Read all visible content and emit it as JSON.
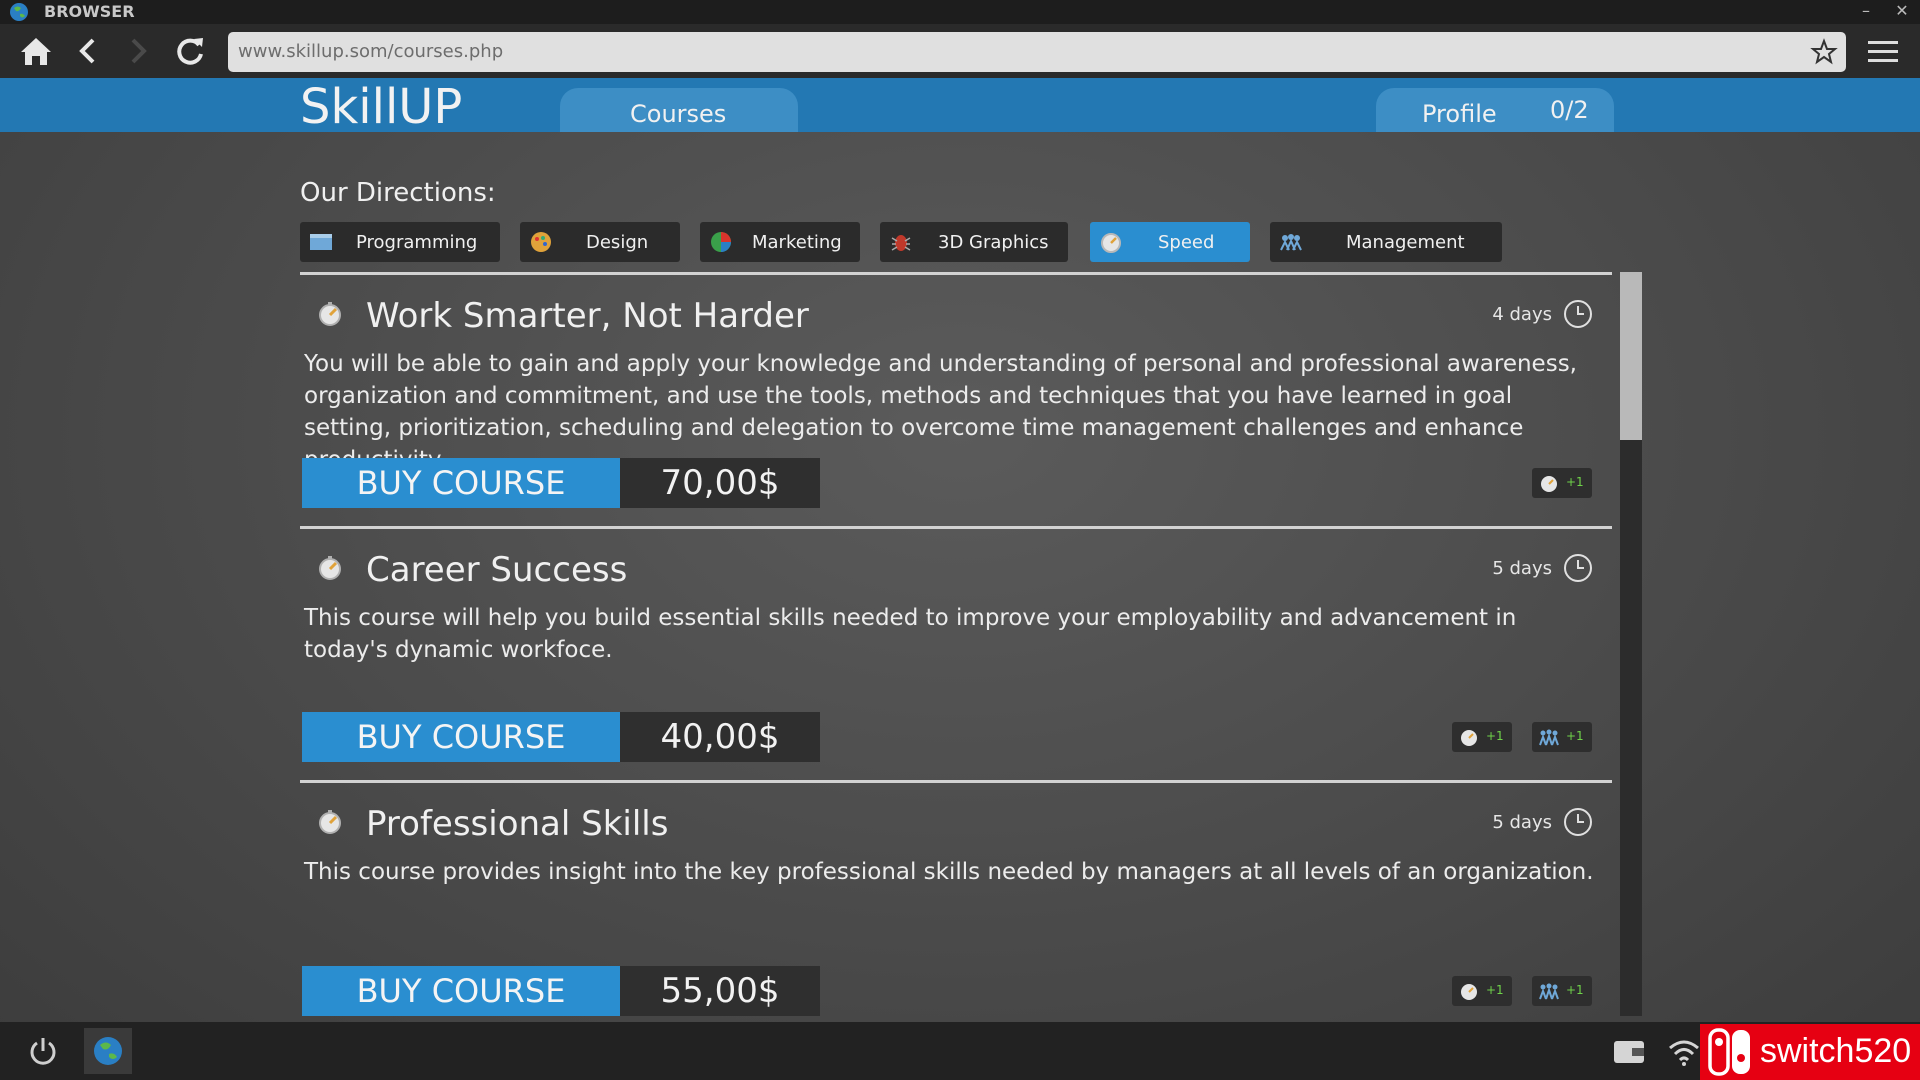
{
  "window": {
    "title": "BROWSER",
    "minimize": "–",
    "close": "✕"
  },
  "toolbar": {
    "home_icon": "home-icon",
    "back_icon": "back-arrow-icon",
    "forward_icon": "forward-arrow-icon",
    "reload_icon": "reload-icon",
    "url": "www.skillup.som/courses.php",
    "bookmark_icon": "star-icon",
    "menu_icon": "hamburger-menu-icon"
  },
  "site": {
    "logo": "SkillUP",
    "tabs": {
      "courses": "Courses",
      "profile": "Profile",
      "profile_count": "0/2"
    }
  },
  "directions": {
    "label": "Our Directions:",
    "items": [
      {
        "label": "Programming",
        "icon": "code-window-icon"
      },
      {
        "label": "Design",
        "icon": "palette-icon"
      },
      {
        "label": "Marketing",
        "icon": "pie-chart-icon"
      },
      {
        "label": "3D Graphics",
        "icon": "bug-icon"
      },
      {
        "label": "Speed",
        "icon": "stopwatch-icon",
        "active": true
      },
      {
        "label": "Management",
        "icon": "team-icon"
      }
    ]
  },
  "courses": [
    {
      "title": "Work Smarter, Not Harder",
      "duration": "4 days",
      "description": "You will be able to gain and apply your knowledge and understanding of personal and professional awareness, organization and commitment, and use the tools, methods and techniques that you have learned in goal setting, prioritization, scheduling and delegation to overcome time management challenges and enhance productivity.",
      "buy_label": "BUY COURSE",
      "price": "70,00$",
      "rewards": [
        {
          "icon": "stopwatch-icon",
          "label": "+1"
        }
      ]
    },
    {
      "title": "Career Success",
      "duration": "5 days",
      "description": "This course will help you build essential skills needed to improve your employability and advancement in today's dynamic workfoce.",
      "buy_label": "BUY COURSE",
      "price": "40,00$",
      "rewards": [
        {
          "icon": "stopwatch-icon",
          "label": "+1"
        },
        {
          "icon": "team-icon",
          "label": "+1"
        }
      ]
    },
    {
      "title": "Professional Skills",
      "duration": "5 days",
      "description": "This course provides insight into the key professional skills needed by managers at all levels of an organization.",
      "buy_label": "BUY COURSE",
      "price": "55,00$",
      "rewards": [
        {
          "icon": "stopwatch-icon",
          "label": "+1"
        },
        {
          "icon": "team-icon",
          "label": "+1"
        }
      ]
    }
  ],
  "taskbar": {
    "power_icon": "power-icon",
    "browser_icon": "globe-icon",
    "wallet_icon": "wallet-icon",
    "wifi_icon": "wifi-icon"
  },
  "watermark": {
    "text": "switch520"
  },
  "colors": {
    "accent": "#2a8ed0",
    "header": "#2378b3",
    "reward": "#6fd24a"
  }
}
